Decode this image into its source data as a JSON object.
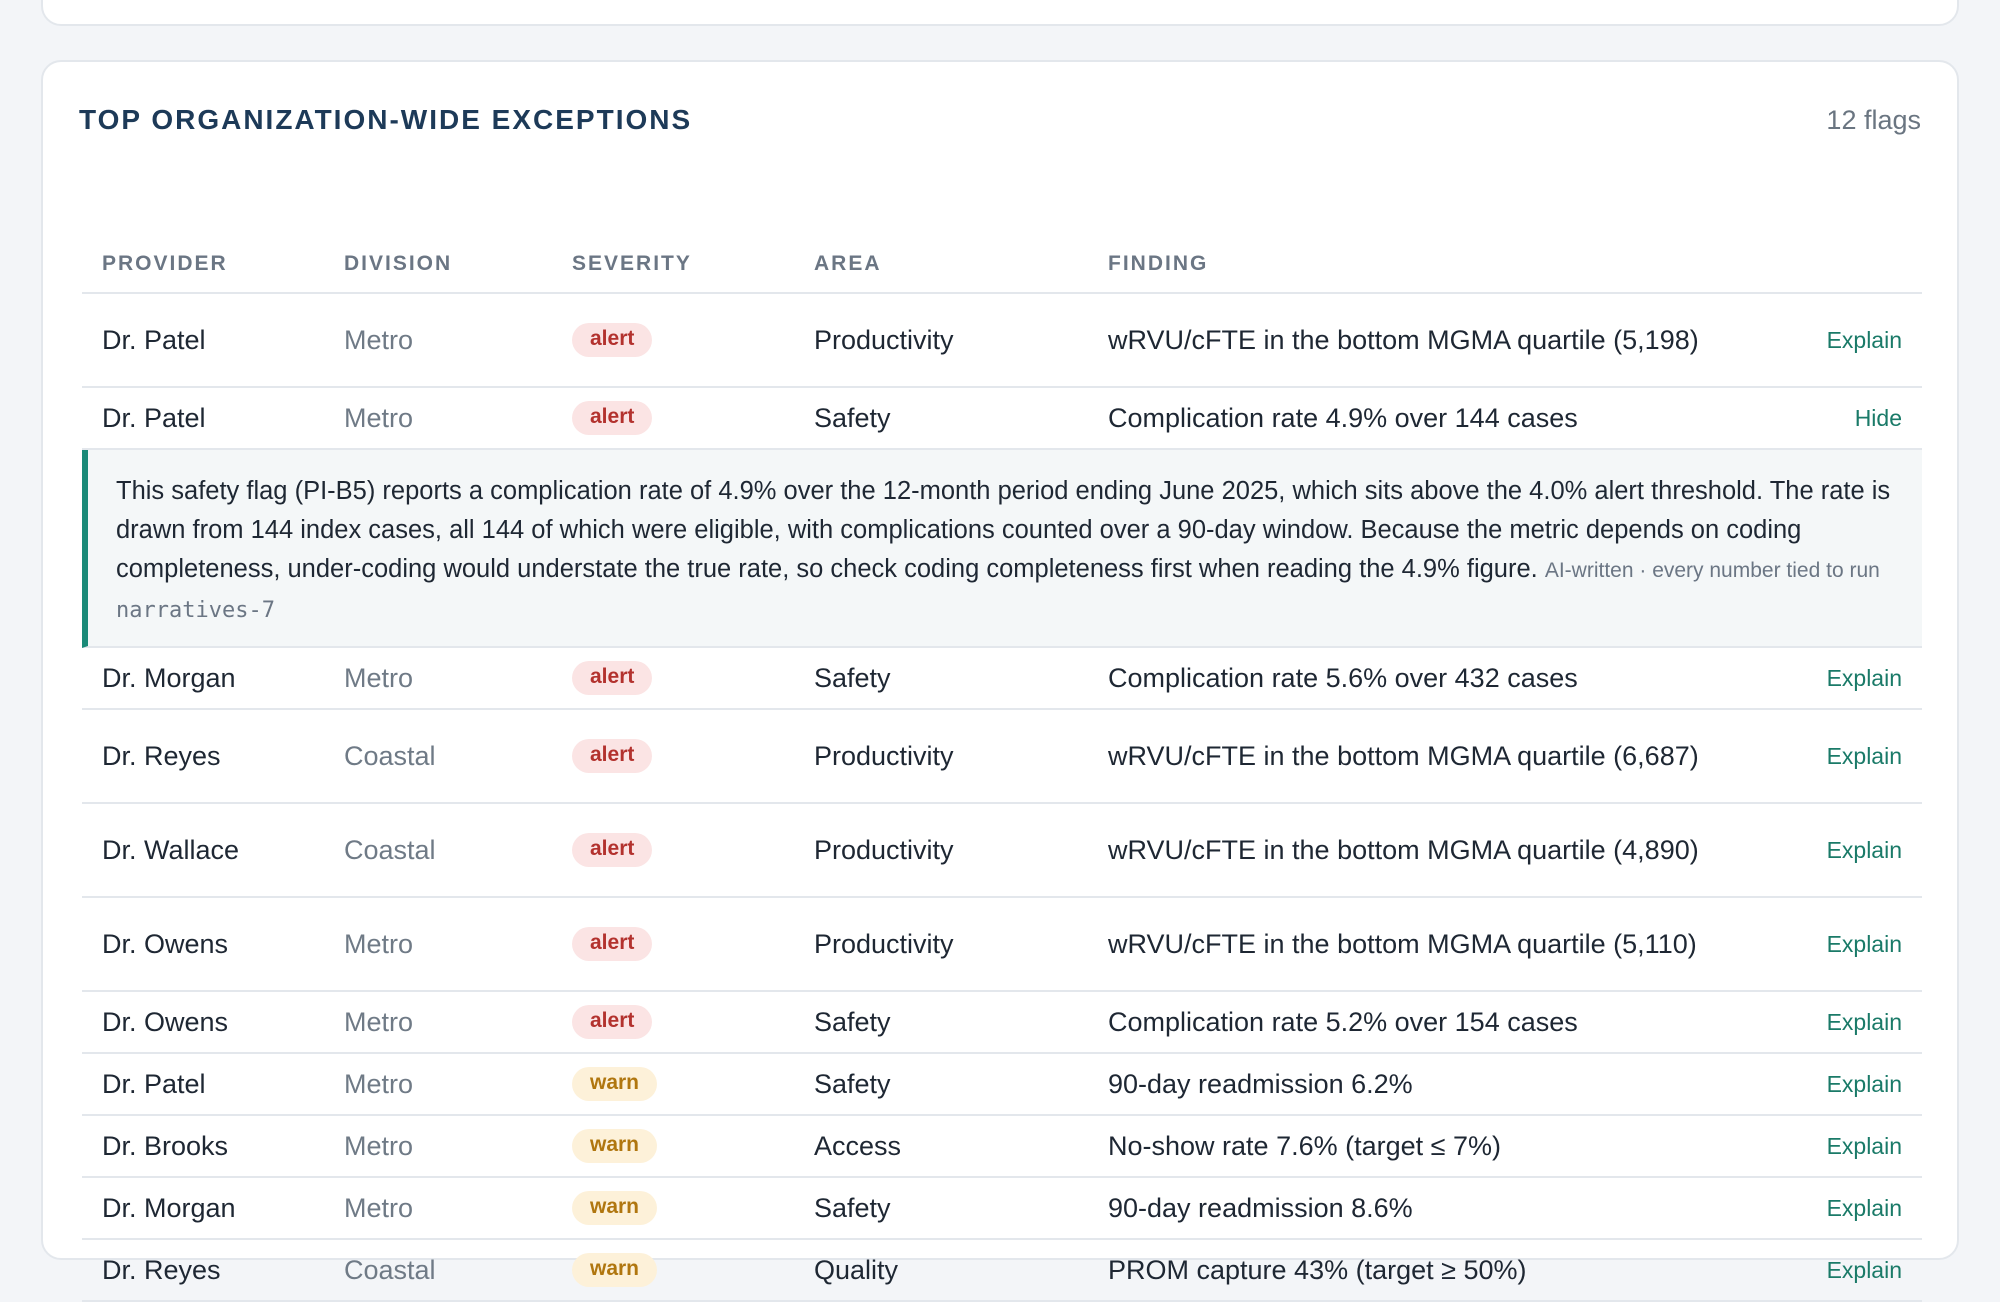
{
  "card": {
    "title": "TOP ORGANIZATION-WIDE EXCEPTIONS",
    "count": "12 flags"
  },
  "columns": {
    "provider": "PROVIDER",
    "division": "DIVISION",
    "severity": "SEVERITY",
    "area": "AREA",
    "finding": "FINDING"
  },
  "rows": [
    {
      "provider": "Dr. Patel",
      "division": "Metro",
      "severity": "alert",
      "area": "Productivity",
      "finding": "wRVU/cFTE in the bottom MGMA quartile (5,198)",
      "action": "Explain"
    },
    {
      "provider": "Dr. Patel",
      "division": "Metro",
      "severity": "alert",
      "area": "Safety",
      "finding": "Complication rate 4.9% over 144 cases",
      "action": "Hide"
    },
    {
      "provider": "Dr. Morgan",
      "division": "Metro",
      "severity": "alert",
      "area": "Safety",
      "finding": "Complication rate 5.6% over 432 cases",
      "action": "Explain"
    },
    {
      "provider": "Dr. Reyes",
      "division": "Coastal",
      "severity": "alert",
      "area": "Productivity",
      "finding": "wRVU/cFTE in the bottom MGMA quartile (6,687)",
      "action": "Explain"
    },
    {
      "provider": "Dr. Wallace",
      "division": "Coastal",
      "severity": "alert",
      "area": "Productivity",
      "finding": "wRVU/cFTE in the bottom MGMA quartile (4,890)",
      "action": "Explain"
    },
    {
      "provider": "Dr. Owens",
      "division": "Metro",
      "severity": "alert",
      "area": "Productivity",
      "finding": "wRVU/cFTE in the bottom MGMA quartile (5,110)",
      "action": "Explain"
    },
    {
      "provider": "Dr. Owens",
      "division": "Metro",
      "severity": "alert",
      "area": "Safety",
      "finding": "Complication rate 5.2% over 154 cases",
      "action": "Explain"
    },
    {
      "provider": "Dr. Patel",
      "division": "Metro",
      "severity": "warn",
      "area": "Safety",
      "finding": "90-day readmission 6.2%",
      "action": "Explain"
    },
    {
      "provider": "Dr. Brooks",
      "division": "Metro",
      "severity": "warn",
      "area": "Access",
      "finding": "No-show rate 7.6% (target ≤ 7%)",
      "action": "Explain"
    },
    {
      "provider": "Dr. Morgan",
      "division": "Metro",
      "severity": "warn",
      "area": "Safety",
      "finding": "90-day readmission 8.6%",
      "action": "Explain"
    },
    {
      "provider": "Dr. Reyes",
      "division": "Coastal",
      "severity": "warn",
      "area": "Quality",
      "finding": "PROM capture 43% (target ≥ 50%)",
      "action": "Explain"
    }
  ],
  "explanation": {
    "text": "This safety flag (PI-B5) reports a complication rate of 4.9% over the 12-month period ending June 2025, which sits above the 4.0% alert threshold. The rate is drawn from 144 index cases, all 144 of which were eligible, with complications counted over a 90-day window. Because the metric depends on coding completeness, under-coding would understate the true rate, so check coding completeness first when reading the 4.9% figure.",
    "meta": "AI-written · every number tied to run",
    "run_id": "narratives-7"
  },
  "colors": {
    "accent": "#1a8a78",
    "alert_bg": "#fbe4e4",
    "alert_text": "#b3322e",
    "warn_bg": "#fdf1d9",
    "warn_text": "#b0760f",
    "title": "#1d3a58"
  }
}
